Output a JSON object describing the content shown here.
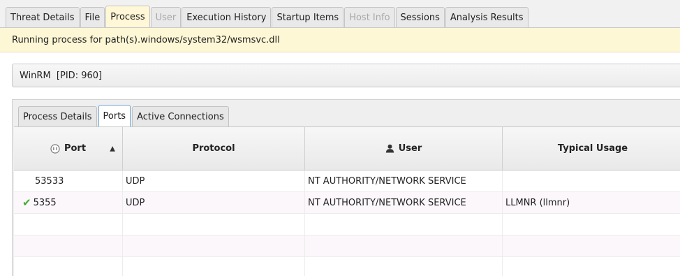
{
  "top_tabs": [
    {
      "label": "Threat Details",
      "state": "normal"
    },
    {
      "label": "File",
      "state": "normal"
    },
    {
      "label": "Process",
      "state": "active"
    },
    {
      "label": "User",
      "state": "disabled"
    },
    {
      "label": "Execution History",
      "state": "normal"
    },
    {
      "label": "Startup Items",
      "state": "normal"
    },
    {
      "label": "Host Info",
      "state": "disabled"
    },
    {
      "label": "Sessions",
      "state": "normal"
    },
    {
      "label": "Analysis Results",
      "state": "normal"
    }
  ],
  "banner": {
    "text": "Running process for path(s).windows/system32/wsmsvc.dll"
  },
  "process_selector": {
    "value": "WinRM  [PID: 960]"
  },
  "inner_tabs": [
    {
      "label": "Process Details",
      "state": "normal"
    },
    {
      "label": "Ports",
      "state": "active"
    },
    {
      "label": "Active Connections",
      "state": "normal"
    }
  ],
  "table": {
    "columns": [
      {
        "label": "Port",
        "icon": "port-icon",
        "sorted": "ascending"
      },
      {
        "label": "Protocol"
      },
      {
        "label": "User",
        "icon": "user-icon"
      },
      {
        "label": "Typical Usage"
      }
    ],
    "rows": [
      {
        "port": "53533",
        "protocol": "UDP",
        "user": "NT AUTHORITY/NETWORK SERVICE",
        "usage": "",
        "checked": false
      },
      {
        "port": "5355",
        "protocol": "UDP",
        "user": "NT AUTHORITY/NETWORK SERVICE",
        "usage": "LLMNR (llmnr)",
        "checked": true
      }
    ]
  },
  "colors": {
    "check": "#3cae2f",
    "banner": "#fdf7d5",
    "active_tab_border": "#6fa3d6"
  }
}
